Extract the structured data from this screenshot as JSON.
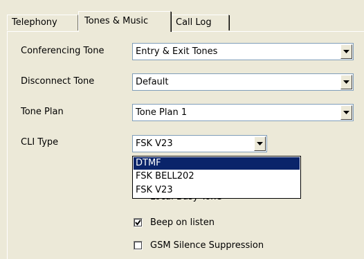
{
  "tabs": [
    {
      "label": "Telephony"
    },
    {
      "label": "Tones & Music"
    },
    {
      "label": "Call Log"
    }
  ],
  "fields": {
    "conferencing_tone": {
      "label": "Conferencing Tone",
      "value": "Entry & Exit Tones"
    },
    "disconnect_tone": {
      "label": "Disconnect Tone",
      "value": "Default"
    },
    "tone_plan": {
      "label": "Tone Plan",
      "value": "Tone Plan 1"
    },
    "cli_type": {
      "label": "CLI Type",
      "value": "FSK V23"
    }
  },
  "cli_dropdown": {
    "options": [
      "DTMF",
      "FSK BELL202",
      "FSK V23"
    ],
    "highlighted": "DTMF"
  },
  "checkboxes": {
    "partial_label": "Local Busy Tone",
    "beep_on_listen": {
      "label": "Beep on listen",
      "checked": true
    },
    "gsm_silence": {
      "label": "GSM Silence Suppression",
      "checked": false
    }
  }
}
